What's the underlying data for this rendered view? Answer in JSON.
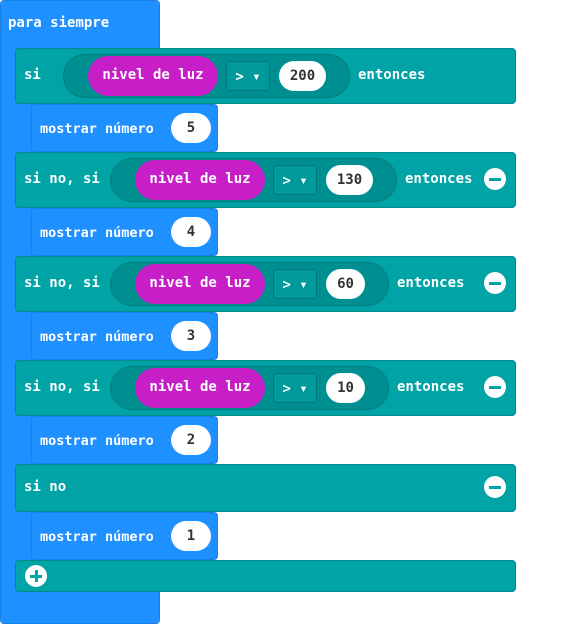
{
  "forever": {
    "label": "para siempre"
  },
  "if_block": {
    "if_label": "si",
    "elseif_label": "si no, si",
    "else_label": "si no",
    "then_label": "entonces",
    "sensor_label": "nivel de luz",
    "operator": "> ▾"
  },
  "branches": [
    {
      "threshold": "200",
      "action_label": "mostrar número",
      "action_value": "5"
    },
    {
      "threshold": "130",
      "action_label": "mostrar número",
      "action_value": "4"
    },
    {
      "threshold": "60",
      "action_label": "mostrar número",
      "action_value": "3"
    },
    {
      "threshold": "10",
      "action_label": "mostrar número",
      "action_value": "2"
    },
    {
      "action_label": "mostrar número",
      "action_value": "1"
    }
  ],
  "colors": {
    "loops_blue": "#1E90FF",
    "logic_teal": "#00A4A6",
    "sensor_magenta": "#C81EC8"
  },
  "icons": {
    "remove": "minus-circle-icon",
    "add": "plus-circle-icon"
  }
}
